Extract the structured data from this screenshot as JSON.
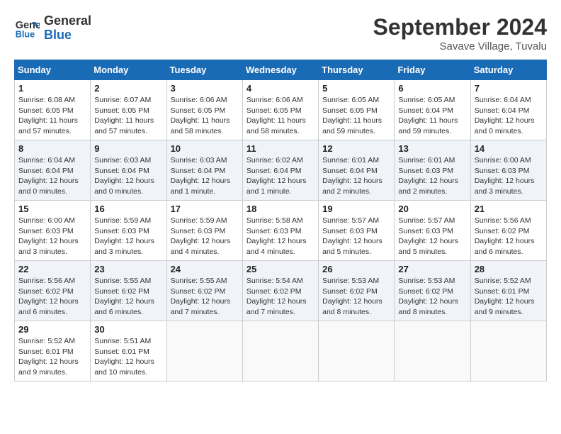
{
  "header": {
    "logo_line1": "General",
    "logo_line2": "Blue",
    "month": "September 2024",
    "location": "Savave Village, Tuvalu"
  },
  "weekdays": [
    "Sunday",
    "Monday",
    "Tuesday",
    "Wednesday",
    "Thursday",
    "Friday",
    "Saturday"
  ],
  "weeks": [
    [
      {
        "day": "1",
        "info": "Sunrise: 6:08 AM\nSunset: 6:05 PM\nDaylight: 11 hours\nand 57 minutes."
      },
      {
        "day": "2",
        "info": "Sunrise: 6:07 AM\nSunset: 6:05 PM\nDaylight: 11 hours\nand 57 minutes."
      },
      {
        "day": "3",
        "info": "Sunrise: 6:06 AM\nSunset: 6:05 PM\nDaylight: 11 hours\nand 58 minutes."
      },
      {
        "day": "4",
        "info": "Sunrise: 6:06 AM\nSunset: 6:05 PM\nDaylight: 11 hours\nand 58 minutes."
      },
      {
        "day": "5",
        "info": "Sunrise: 6:05 AM\nSunset: 6:05 PM\nDaylight: 11 hours\nand 59 minutes."
      },
      {
        "day": "6",
        "info": "Sunrise: 6:05 AM\nSunset: 6:04 PM\nDaylight: 11 hours\nand 59 minutes."
      },
      {
        "day": "7",
        "info": "Sunrise: 6:04 AM\nSunset: 6:04 PM\nDaylight: 12 hours\nand 0 minutes."
      }
    ],
    [
      {
        "day": "8",
        "info": "Sunrise: 6:04 AM\nSunset: 6:04 PM\nDaylight: 12 hours\nand 0 minutes."
      },
      {
        "day": "9",
        "info": "Sunrise: 6:03 AM\nSunset: 6:04 PM\nDaylight: 12 hours\nand 0 minutes."
      },
      {
        "day": "10",
        "info": "Sunrise: 6:03 AM\nSunset: 6:04 PM\nDaylight: 12 hours\nand 1 minute."
      },
      {
        "day": "11",
        "info": "Sunrise: 6:02 AM\nSunset: 6:04 PM\nDaylight: 12 hours\nand 1 minute."
      },
      {
        "day": "12",
        "info": "Sunrise: 6:01 AM\nSunset: 6:04 PM\nDaylight: 12 hours\nand 2 minutes."
      },
      {
        "day": "13",
        "info": "Sunrise: 6:01 AM\nSunset: 6:03 PM\nDaylight: 12 hours\nand 2 minutes."
      },
      {
        "day": "14",
        "info": "Sunrise: 6:00 AM\nSunset: 6:03 PM\nDaylight: 12 hours\nand 3 minutes."
      }
    ],
    [
      {
        "day": "15",
        "info": "Sunrise: 6:00 AM\nSunset: 6:03 PM\nDaylight: 12 hours\nand 3 minutes."
      },
      {
        "day": "16",
        "info": "Sunrise: 5:59 AM\nSunset: 6:03 PM\nDaylight: 12 hours\nand 3 minutes."
      },
      {
        "day": "17",
        "info": "Sunrise: 5:59 AM\nSunset: 6:03 PM\nDaylight: 12 hours\nand 4 minutes."
      },
      {
        "day": "18",
        "info": "Sunrise: 5:58 AM\nSunset: 6:03 PM\nDaylight: 12 hours\nand 4 minutes."
      },
      {
        "day": "19",
        "info": "Sunrise: 5:57 AM\nSunset: 6:03 PM\nDaylight: 12 hours\nand 5 minutes."
      },
      {
        "day": "20",
        "info": "Sunrise: 5:57 AM\nSunset: 6:03 PM\nDaylight: 12 hours\nand 5 minutes."
      },
      {
        "day": "21",
        "info": "Sunrise: 5:56 AM\nSunset: 6:02 PM\nDaylight: 12 hours\nand 6 minutes."
      }
    ],
    [
      {
        "day": "22",
        "info": "Sunrise: 5:56 AM\nSunset: 6:02 PM\nDaylight: 12 hours\nand 6 minutes."
      },
      {
        "day": "23",
        "info": "Sunrise: 5:55 AM\nSunset: 6:02 PM\nDaylight: 12 hours\nand 6 minutes."
      },
      {
        "day": "24",
        "info": "Sunrise: 5:55 AM\nSunset: 6:02 PM\nDaylight: 12 hours\nand 7 minutes."
      },
      {
        "day": "25",
        "info": "Sunrise: 5:54 AM\nSunset: 6:02 PM\nDaylight: 12 hours\nand 7 minutes."
      },
      {
        "day": "26",
        "info": "Sunrise: 5:53 AM\nSunset: 6:02 PM\nDaylight: 12 hours\nand 8 minutes."
      },
      {
        "day": "27",
        "info": "Sunrise: 5:53 AM\nSunset: 6:02 PM\nDaylight: 12 hours\nand 8 minutes."
      },
      {
        "day": "28",
        "info": "Sunrise: 5:52 AM\nSunset: 6:01 PM\nDaylight: 12 hours\nand 9 minutes."
      }
    ],
    [
      {
        "day": "29",
        "info": "Sunrise: 5:52 AM\nSunset: 6:01 PM\nDaylight: 12 hours\nand 9 minutes."
      },
      {
        "day": "30",
        "info": "Sunrise: 5:51 AM\nSunset: 6:01 PM\nDaylight: 12 hours\nand 10 minutes."
      },
      {
        "day": "",
        "info": ""
      },
      {
        "day": "",
        "info": ""
      },
      {
        "day": "",
        "info": ""
      },
      {
        "day": "",
        "info": ""
      },
      {
        "day": "",
        "info": ""
      }
    ]
  ]
}
